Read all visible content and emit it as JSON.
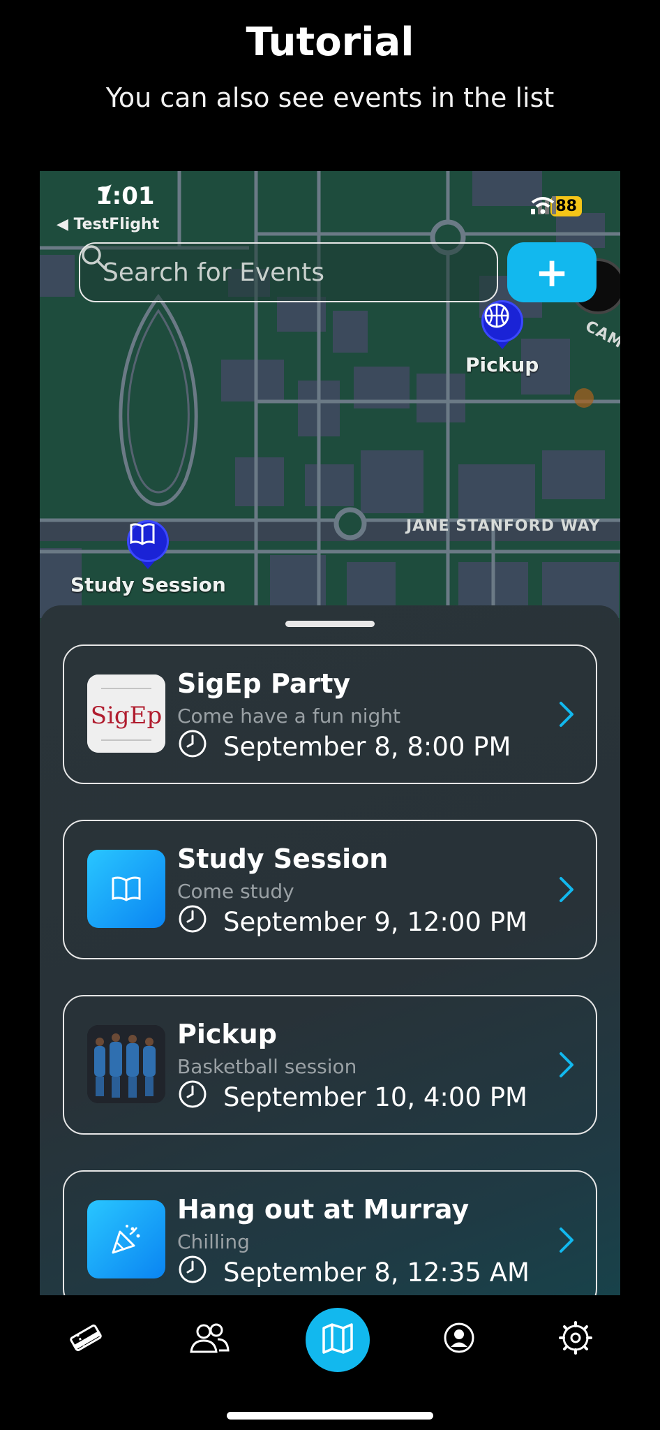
{
  "tutorial": {
    "title": "Tutorial",
    "subtitle": "You can also see events in the list"
  },
  "status_bar": {
    "time": "1:01",
    "back_app": "◀ TestFlight",
    "battery": "88"
  },
  "search": {
    "placeholder": "Search for Events"
  },
  "add_button": {
    "label": "+"
  },
  "map": {
    "pins": [
      {
        "label": "Pickup",
        "icon": "basketball-icon"
      },
      {
        "label": "Study Session",
        "icon": "book-icon"
      }
    ],
    "streets": [
      "JANE STANFORD WAY",
      "CAM"
    ]
  },
  "events": [
    {
      "name": "SigEp Party",
      "description": "Come have a fun night",
      "when": "September 8, 8:00 PM",
      "thumb": "sigep-logo",
      "logo_text": "SigEp"
    },
    {
      "name": "Study Session",
      "description": "Come study",
      "when": "September 9, 12:00 PM",
      "thumb": "book-icon"
    },
    {
      "name": "Pickup",
      "description": "Basketball session",
      "when": "September 10, 4:00 PM",
      "thumb": "basketball-team-photo"
    },
    {
      "name": "Hang out at Murray",
      "description": "Chilling",
      "when": "September 8, 12:35 AM",
      "thumb": "party-popper-icon"
    }
  ],
  "tabbar": {
    "items": [
      "tickets-icon",
      "friends-icon",
      "map-icon",
      "profile-icon",
      "settings-icon"
    ],
    "active": "map-icon"
  },
  "colors": {
    "accent": "#12b8ee",
    "pin": "#1a23d6",
    "battery": "#f5c518"
  }
}
